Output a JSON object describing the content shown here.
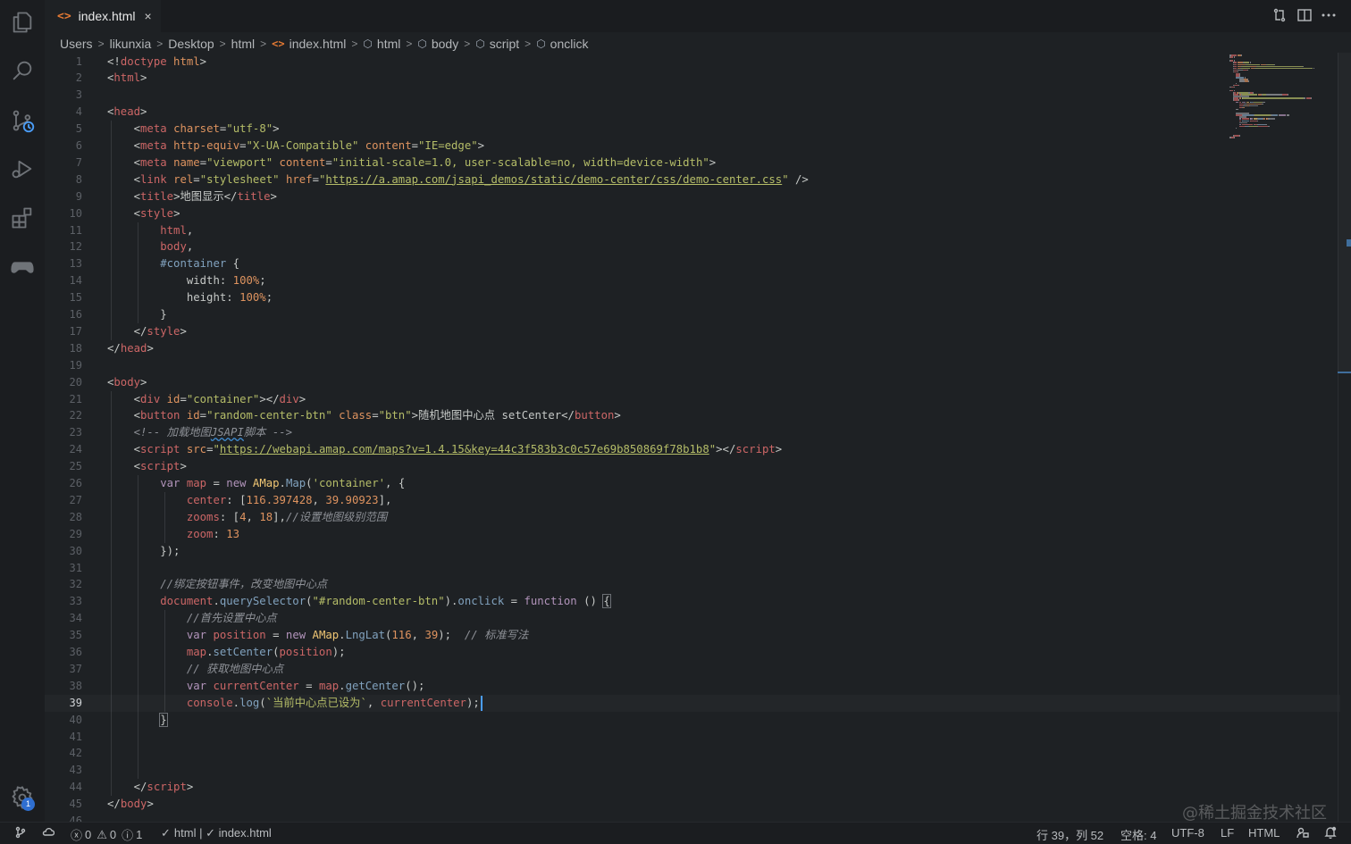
{
  "tab": {
    "icon": "<>",
    "filename": "index.html",
    "close": "×"
  },
  "breadcrumb": {
    "items": [
      "Users",
      "likunxia",
      "Desktop",
      "html",
      "index.html",
      "html",
      "body",
      "script",
      "onclick"
    ],
    "separator": ">"
  },
  "editor": {
    "active_line": 39,
    "cursor": {
      "line": 39,
      "column": 52
    },
    "lines": [
      [
        [
          "tk-txt",
          "<!"
        ],
        [
          "tk-tag",
          "doctype"
        ],
        [
          "tk-txt",
          " "
        ],
        [
          "tk-attr",
          "html"
        ],
        [
          "tk-txt",
          ">"
        ]
      ],
      [
        [
          "tk-txt",
          "<"
        ],
        [
          "tk-tag",
          "html"
        ],
        [
          "tk-txt",
          ">"
        ]
      ],
      [],
      [
        [
          "tk-txt",
          "<"
        ],
        [
          "tk-tag",
          "head"
        ],
        [
          "tk-txt",
          ">"
        ]
      ],
      [
        [
          "tk-txt",
          "    <"
        ],
        [
          "tk-tag",
          "meta"
        ],
        [
          "tk-txt",
          " "
        ],
        [
          "tk-attr",
          "charset"
        ],
        [
          "tk-txt",
          "="
        ],
        [
          "tk-str",
          "\"utf-8\""
        ],
        [
          "tk-txt",
          ">"
        ]
      ],
      [
        [
          "tk-txt",
          "    <"
        ],
        [
          "tk-tag",
          "meta"
        ],
        [
          "tk-txt",
          " "
        ],
        [
          "tk-attr",
          "http-equiv"
        ],
        [
          "tk-txt",
          "="
        ],
        [
          "tk-str",
          "\"X-UA-Compatible\""
        ],
        [
          "tk-txt",
          " "
        ],
        [
          "tk-attr",
          "content"
        ],
        [
          "tk-txt",
          "="
        ],
        [
          "tk-str",
          "\"IE=edge\""
        ],
        [
          "tk-txt",
          ">"
        ]
      ],
      [
        [
          "tk-txt",
          "    <"
        ],
        [
          "tk-tag",
          "meta"
        ],
        [
          "tk-txt",
          " "
        ],
        [
          "tk-attr",
          "name"
        ],
        [
          "tk-txt",
          "="
        ],
        [
          "tk-str",
          "\"viewport\""
        ],
        [
          "tk-txt",
          " "
        ],
        [
          "tk-attr",
          "content"
        ],
        [
          "tk-txt",
          "="
        ],
        [
          "tk-str",
          "\"initial-scale=1.0, user-scalable=no, width=device-width\""
        ],
        [
          "tk-txt",
          ">"
        ]
      ],
      [
        [
          "tk-txt",
          "    <"
        ],
        [
          "tk-tag",
          "link"
        ],
        [
          "tk-txt",
          " "
        ],
        [
          "tk-attr",
          "rel"
        ],
        [
          "tk-txt",
          "="
        ],
        [
          "tk-str",
          "\"stylesheet\""
        ],
        [
          "tk-txt",
          " "
        ],
        [
          "tk-attr",
          "href"
        ],
        [
          "tk-txt",
          "="
        ],
        [
          "tk-str",
          "\""
        ],
        [
          "tk-url",
          "https://a.amap.com/jsapi_demos/static/demo-center/css/demo-center.css"
        ],
        [
          "tk-str",
          "\""
        ],
        [
          "tk-txt",
          " />"
        ]
      ],
      [
        [
          "tk-txt",
          "    <"
        ],
        [
          "tk-tag",
          "title"
        ],
        [
          "tk-txt",
          ">地图显示</"
        ],
        [
          "tk-tag",
          "title"
        ],
        [
          "tk-txt",
          ">"
        ]
      ],
      [
        [
          "tk-txt",
          "    <"
        ],
        [
          "tk-tag",
          "style"
        ],
        [
          "tk-txt",
          ">"
        ]
      ],
      [
        [
          "tk-txt",
          "        "
        ],
        [
          "tk-var",
          "html"
        ],
        [
          "tk-txt",
          ","
        ]
      ],
      [
        [
          "tk-txt",
          "        "
        ],
        [
          "tk-var",
          "body"
        ],
        [
          "tk-txt",
          ","
        ]
      ],
      [
        [
          "tk-txt",
          "        "
        ],
        [
          "tk-sel",
          "#container"
        ],
        [
          "tk-txt",
          " {"
        ]
      ],
      [
        [
          "tk-txt",
          "            width: "
        ],
        [
          "tk-num",
          "100%"
        ],
        [
          "tk-txt",
          ";"
        ]
      ],
      [
        [
          "tk-txt",
          "            height: "
        ],
        [
          "tk-num",
          "100%"
        ],
        [
          "tk-txt",
          ";"
        ]
      ],
      [
        [
          "tk-txt",
          "        }"
        ]
      ],
      [
        [
          "tk-txt",
          "    </"
        ],
        [
          "tk-tag",
          "style"
        ],
        [
          "tk-txt",
          ">"
        ]
      ],
      [
        [
          "tk-txt",
          "</"
        ],
        [
          "tk-tag",
          "head"
        ],
        [
          "tk-txt",
          ">"
        ]
      ],
      [],
      [
        [
          "tk-txt",
          "<"
        ],
        [
          "tk-tag",
          "body"
        ],
        [
          "tk-txt",
          ">"
        ]
      ],
      [
        [
          "tk-txt",
          "    <"
        ],
        [
          "tk-tag",
          "div"
        ],
        [
          "tk-txt",
          " "
        ],
        [
          "tk-attr",
          "id"
        ],
        [
          "tk-txt",
          "="
        ],
        [
          "tk-str",
          "\"container\""
        ],
        [
          "tk-txt",
          "></"
        ],
        [
          "tk-tag",
          "div"
        ],
        [
          "tk-txt",
          ">"
        ]
      ],
      [
        [
          "tk-txt",
          "    <"
        ],
        [
          "tk-tag",
          "button"
        ],
        [
          "tk-txt",
          " "
        ],
        [
          "tk-attr",
          "id"
        ],
        [
          "tk-txt",
          "="
        ],
        [
          "tk-str",
          "\"random-center-btn\""
        ],
        [
          "tk-txt",
          " "
        ],
        [
          "tk-attr",
          "class"
        ],
        [
          "tk-txt",
          "="
        ],
        [
          "tk-str",
          "\"btn\""
        ],
        [
          "tk-txt",
          ">随机地图中心点 setCenter</"
        ],
        [
          "tk-tag",
          "button"
        ],
        [
          "tk-txt",
          ">"
        ]
      ],
      [
        [
          "tk-txt",
          "    "
        ],
        [
          "tk-com",
          "<!-- 加载地图"
        ],
        [
          "tk-com tk-wavy",
          "JSAPI"
        ],
        [
          "tk-com",
          "脚本 -->"
        ]
      ],
      [
        [
          "tk-txt",
          "    <"
        ],
        [
          "tk-tag",
          "script"
        ],
        [
          "tk-txt",
          " "
        ],
        [
          "tk-attr",
          "src"
        ],
        [
          "tk-txt",
          "="
        ],
        [
          "tk-str",
          "\""
        ],
        [
          "tk-url",
          "https://webapi.amap.com/maps?v=1.4.15&key=44c3f583b3c0c57e69b850869f78b1b8"
        ],
        [
          "tk-str",
          "\""
        ],
        [
          "tk-txt",
          "></"
        ],
        [
          "tk-tag",
          "script"
        ],
        [
          "tk-txt",
          ">"
        ]
      ],
      [
        [
          "tk-txt",
          "    <"
        ],
        [
          "tk-tag",
          "script"
        ],
        [
          "tk-txt",
          ">"
        ]
      ],
      [
        [
          "tk-txt",
          "        "
        ],
        [
          "tk-kw",
          "var"
        ],
        [
          "tk-txt",
          " "
        ],
        [
          "tk-var",
          "map"
        ],
        [
          "tk-txt",
          " = "
        ],
        [
          "tk-kw",
          "new"
        ],
        [
          "tk-txt",
          " "
        ],
        [
          "tk-cls",
          "AMap"
        ],
        [
          "tk-txt",
          "."
        ],
        [
          "tk-fn",
          "Map"
        ],
        [
          "tk-txt",
          "("
        ],
        [
          "tk-str",
          "'container'"
        ],
        [
          "tk-txt",
          ", {"
        ]
      ],
      [
        [
          "tk-txt",
          "            "
        ],
        [
          "tk-var",
          "center"
        ],
        [
          "tk-txt",
          ": ["
        ],
        [
          "tk-num",
          "116.397428"
        ],
        [
          "tk-txt",
          ", "
        ],
        [
          "tk-num",
          "39.90923"
        ],
        [
          "tk-txt",
          "],"
        ]
      ],
      [
        [
          "tk-txt",
          "            "
        ],
        [
          "tk-var",
          "zooms"
        ],
        [
          "tk-txt",
          ": ["
        ],
        [
          "tk-num",
          "4"
        ],
        [
          "tk-txt",
          ", "
        ],
        [
          "tk-num",
          "18"
        ],
        [
          "tk-txt",
          "],"
        ],
        [
          "tk-com",
          "//设置地图级别范围"
        ]
      ],
      [
        [
          "tk-txt",
          "            "
        ],
        [
          "tk-var",
          "zoom"
        ],
        [
          "tk-txt",
          ": "
        ],
        [
          "tk-num",
          "13"
        ]
      ],
      [
        [
          "tk-txt",
          "        });"
        ]
      ],
      [],
      [
        [
          "tk-txt",
          "        "
        ],
        [
          "tk-com",
          "//绑定按钮事件，改变地图中心点"
        ]
      ],
      [
        [
          "tk-txt",
          "        "
        ],
        [
          "tk-var",
          "document"
        ],
        [
          "tk-txt",
          "."
        ],
        [
          "tk-fn",
          "querySelector"
        ],
        [
          "tk-txt",
          "("
        ],
        [
          "tk-str",
          "\"#random-center-btn\""
        ],
        [
          "tk-txt",
          ")."
        ],
        [
          "tk-fn",
          "onclick"
        ],
        [
          "tk-txt",
          " = "
        ],
        [
          "tk-kw",
          "function"
        ],
        [
          "tk-txt",
          " () "
        ],
        [
          "tk-txt brace-hl",
          "{"
        ]
      ],
      [
        [
          "tk-txt",
          "            "
        ],
        [
          "tk-com",
          "//首先设置中心点"
        ]
      ],
      [
        [
          "tk-txt",
          "            "
        ],
        [
          "tk-kw",
          "var"
        ],
        [
          "tk-txt",
          " "
        ],
        [
          "tk-var",
          "position"
        ],
        [
          "tk-txt",
          " = "
        ],
        [
          "tk-kw",
          "new"
        ],
        [
          "tk-txt",
          " "
        ],
        [
          "tk-cls",
          "AMap"
        ],
        [
          "tk-txt",
          "."
        ],
        [
          "tk-fn",
          "LngLat"
        ],
        [
          "tk-txt",
          "("
        ],
        [
          "tk-num",
          "116"
        ],
        [
          "tk-txt",
          ", "
        ],
        [
          "tk-num",
          "39"
        ],
        [
          "tk-txt",
          ");  "
        ],
        [
          "tk-com",
          "// 标准写法"
        ]
      ],
      [
        [
          "tk-txt",
          "            "
        ],
        [
          "tk-var",
          "map"
        ],
        [
          "tk-txt",
          "."
        ],
        [
          "tk-fn",
          "setCenter"
        ],
        [
          "tk-txt",
          "("
        ],
        [
          "tk-var",
          "position"
        ],
        [
          "tk-txt",
          ");"
        ]
      ],
      [
        [
          "tk-txt",
          "            "
        ],
        [
          "tk-com",
          "// 获取地图中心点"
        ]
      ],
      [
        [
          "tk-txt",
          "            "
        ],
        [
          "tk-kw",
          "var"
        ],
        [
          "tk-txt",
          " "
        ],
        [
          "tk-var",
          "currentCenter"
        ],
        [
          "tk-txt",
          " = "
        ],
        [
          "tk-var",
          "map"
        ],
        [
          "tk-txt",
          "."
        ],
        [
          "tk-fn",
          "getCenter"
        ],
        [
          "tk-txt",
          "();"
        ]
      ],
      [
        [
          "tk-txt",
          "            "
        ],
        [
          "tk-var",
          "console"
        ],
        [
          "tk-txt",
          "."
        ],
        [
          "tk-fn",
          "log"
        ],
        [
          "tk-txt",
          "("
        ],
        [
          "tk-str",
          "`当前中心点已设为`"
        ],
        [
          "tk-txt",
          ", "
        ],
        [
          "tk-var",
          "currentCenter"
        ],
        [
          "tk-txt",
          ");"
        ]
      ],
      [
        [
          "tk-txt",
          "        "
        ],
        [
          "tk-txt brace-hl",
          "}"
        ]
      ],
      [],
      [],
      [],
      [
        [
          "tk-txt",
          "    </"
        ],
        [
          "tk-tag",
          "script"
        ],
        [
          "tk-txt",
          ">"
        ]
      ],
      [
        [
          "tk-txt",
          "</"
        ],
        [
          "tk-tag",
          "body"
        ],
        [
          "tk-txt",
          ">"
        ]
      ],
      []
    ]
  },
  "statusbar": {
    "errors": "0",
    "warnings": "0",
    "infos": "1",
    "language_check": "html | ✓ index.html",
    "check_mark": "✓",
    "position": "行 39，列 52",
    "spaces": "空格: 4",
    "encoding": "UTF-8",
    "eol": "LF",
    "language": "HTML"
  },
  "activity": {
    "settings_badge": "1"
  },
  "watermark": "@稀土掘金技术社区",
  "colors": {
    "background": "#1e2124",
    "cursor": "#4a9df8",
    "tag": "#cc6666",
    "string": "#b5bd68",
    "attr": "#de935f",
    "keyword": "#b294bb",
    "function": "#81a2be"
  }
}
